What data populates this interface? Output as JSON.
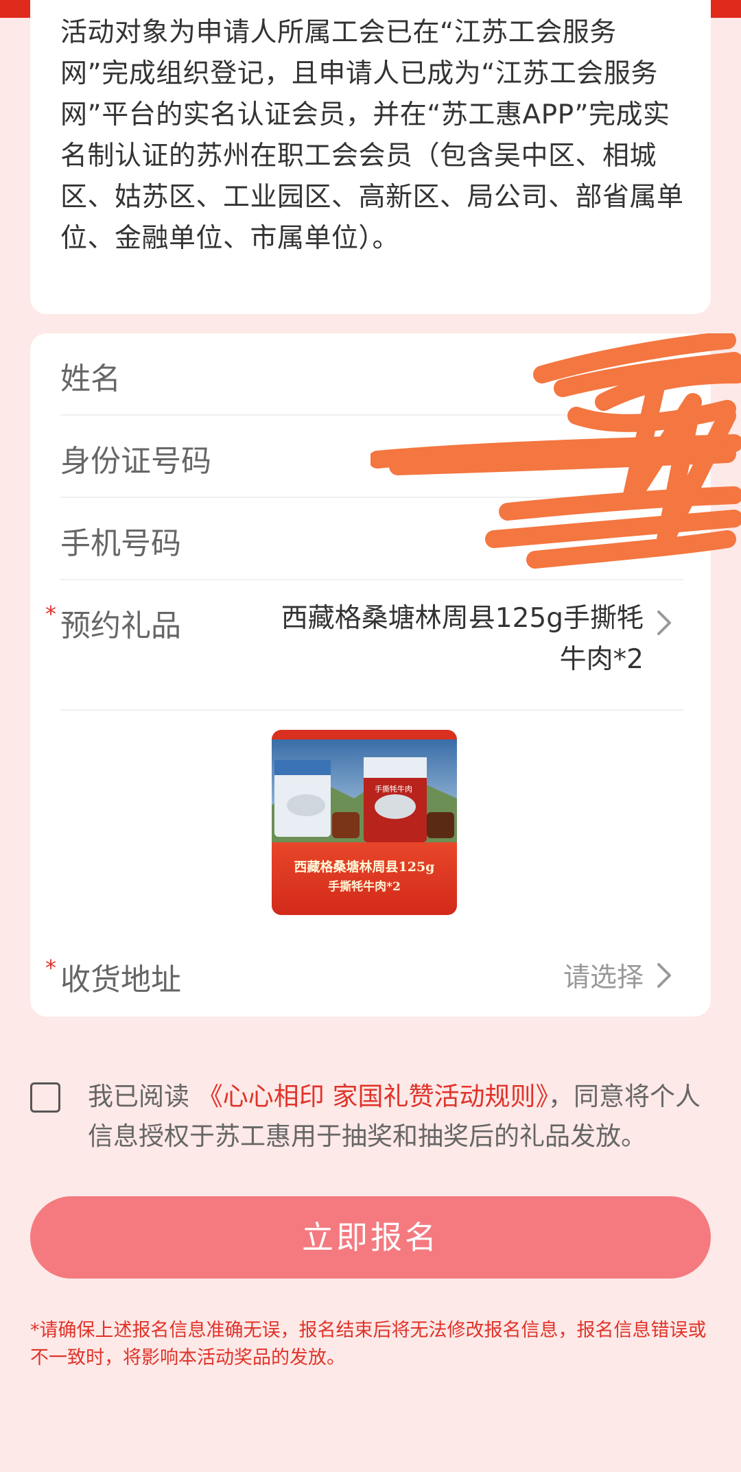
{
  "intro": {
    "text": "活动对象为申请人所属工会已在“江苏工会服务网”完成组织登记，且申请人已成为“江苏工会服务网”平台的实名认证会员，并在“苏工惠APP”完成实名制认证的苏州在职工会会员（包含吴中区、相城区、姑苏区、工业园区、高新区、局公司、部省属单位、金融单位、市属单位）。"
  },
  "form": {
    "name_label": "姓名",
    "id_label": "身份证号码",
    "phone_label": "手机号码",
    "gift_label": "预约礼品",
    "gift_value": "西藏格桑塘林周县125g手撕牦牛肉*2",
    "gift_image": {
      "caption_line1": "西藏格桑塘林周县125g",
      "caption_line2": "手撕牦牛肉*2",
      "bag_text": "手撕牦牛肉"
    },
    "address_label": "收货地址",
    "address_placeholder": "请选择",
    "required_mark": "*"
  },
  "agreement": {
    "prefix": "我已阅读",
    "link": "《心心相印 家国礼赞活动规则》",
    "suffix": "，同意将个人信息授权于苏工惠用于抽奖和抽奖后的礼品发放。",
    "checked": false
  },
  "submit_label": "立即报名",
  "notice": "*请确保上述报名信息准确无误，报名结束后将无法修改报名信息，报名信息错误或不一致时，将影响本活动奖品的发放。",
  "colors": {
    "topbar": "#e02a1c",
    "page_bg": "#fde9e7",
    "accent": "#e0332a",
    "button": "#f47a80",
    "redaction": "#f47640"
  },
  "icons": [
    "chevron-right-icon",
    "checkbox-icon"
  ]
}
